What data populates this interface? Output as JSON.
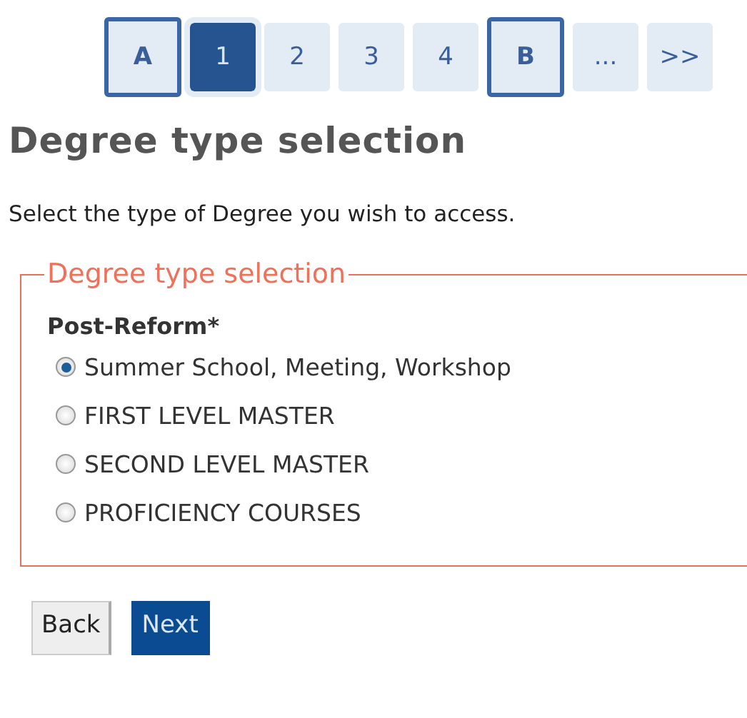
{
  "pagination": [
    {
      "label": "A",
      "kind": "outlined",
      "selected": false
    },
    {
      "label": "1",
      "kind": "page",
      "selected": true
    },
    {
      "label": "2",
      "kind": "page",
      "selected": false
    },
    {
      "label": "3",
      "kind": "page",
      "selected": false
    },
    {
      "label": "4",
      "kind": "page",
      "selected": false
    },
    {
      "label": "B",
      "kind": "outlined",
      "selected": false
    },
    {
      "label": "...",
      "kind": "page",
      "selected": false
    },
    {
      "label": ">>",
      "kind": "page",
      "selected": false
    }
  ],
  "title": "Degree type selection",
  "instruction": "Select the type of Degree you wish to access.",
  "fieldset": {
    "legend": "Degree type selection",
    "group_label": "Post-Reform*",
    "options": [
      {
        "label": "Summer School, Meeting, Workshop",
        "selected": true
      },
      {
        "label": "FIRST LEVEL MASTER",
        "selected": false
      },
      {
        "label": "SECOND LEVEL MASTER",
        "selected": false
      },
      {
        "label": "PROFICIENCY COURSES",
        "selected": false
      }
    ]
  },
  "buttons": [
    {
      "label": "Back",
      "kind": "secondary"
    },
    {
      "label": "Next",
      "kind": "primary"
    }
  ]
}
